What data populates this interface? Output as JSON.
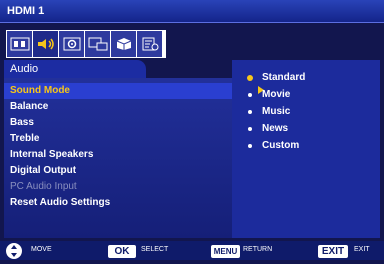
{
  "window": {
    "title": "HDMI 1"
  },
  "tabs": [
    {
      "name": "picture-tab",
      "icon": "picture-icon"
    },
    {
      "name": "audio-tab",
      "icon": "speaker-icon",
      "active": true
    },
    {
      "name": "setup-tab",
      "icon": "gear-icon"
    },
    {
      "name": "pip-tab",
      "icon": "pip-icon"
    },
    {
      "name": "options-tab",
      "icon": "cube-icon"
    },
    {
      "name": "info-tab",
      "icon": "clipboard-clock-icon"
    }
  ],
  "panel": {
    "title": "Audio"
  },
  "menu": [
    {
      "label": "Sound Mode",
      "selected": true
    },
    {
      "label": "Balance"
    },
    {
      "label": "Bass"
    },
    {
      "label": "Treble"
    },
    {
      "label": "Internal Speakers"
    },
    {
      "label": "Digital Output"
    },
    {
      "label": "PC Audio Input",
      "disabled": true
    },
    {
      "label": "Reset Audio Settings"
    }
  ],
  "options": [
    {
      "label": "Standard",
      "checked": true
    },
    {
      "label": "Movie"
    },
    {
      "label": "Music"
    },
    {
      "label": "News"
    },
    {
      "label": "Custom"
    }
  ],
  "footer": {
    "move": "MOVE",
    "ok_key": "OK",
    "select": "SELECT",
    "menu_key": "MENU",
    "return": "RETURN",
    "exit_key": "EXIT",
    "exit": "EXIT"
  },
  "colors": {
    "background": "#12164e",
    "accent": "#f6c61a",
    "selection": "#2a3fd0"
  }
}
